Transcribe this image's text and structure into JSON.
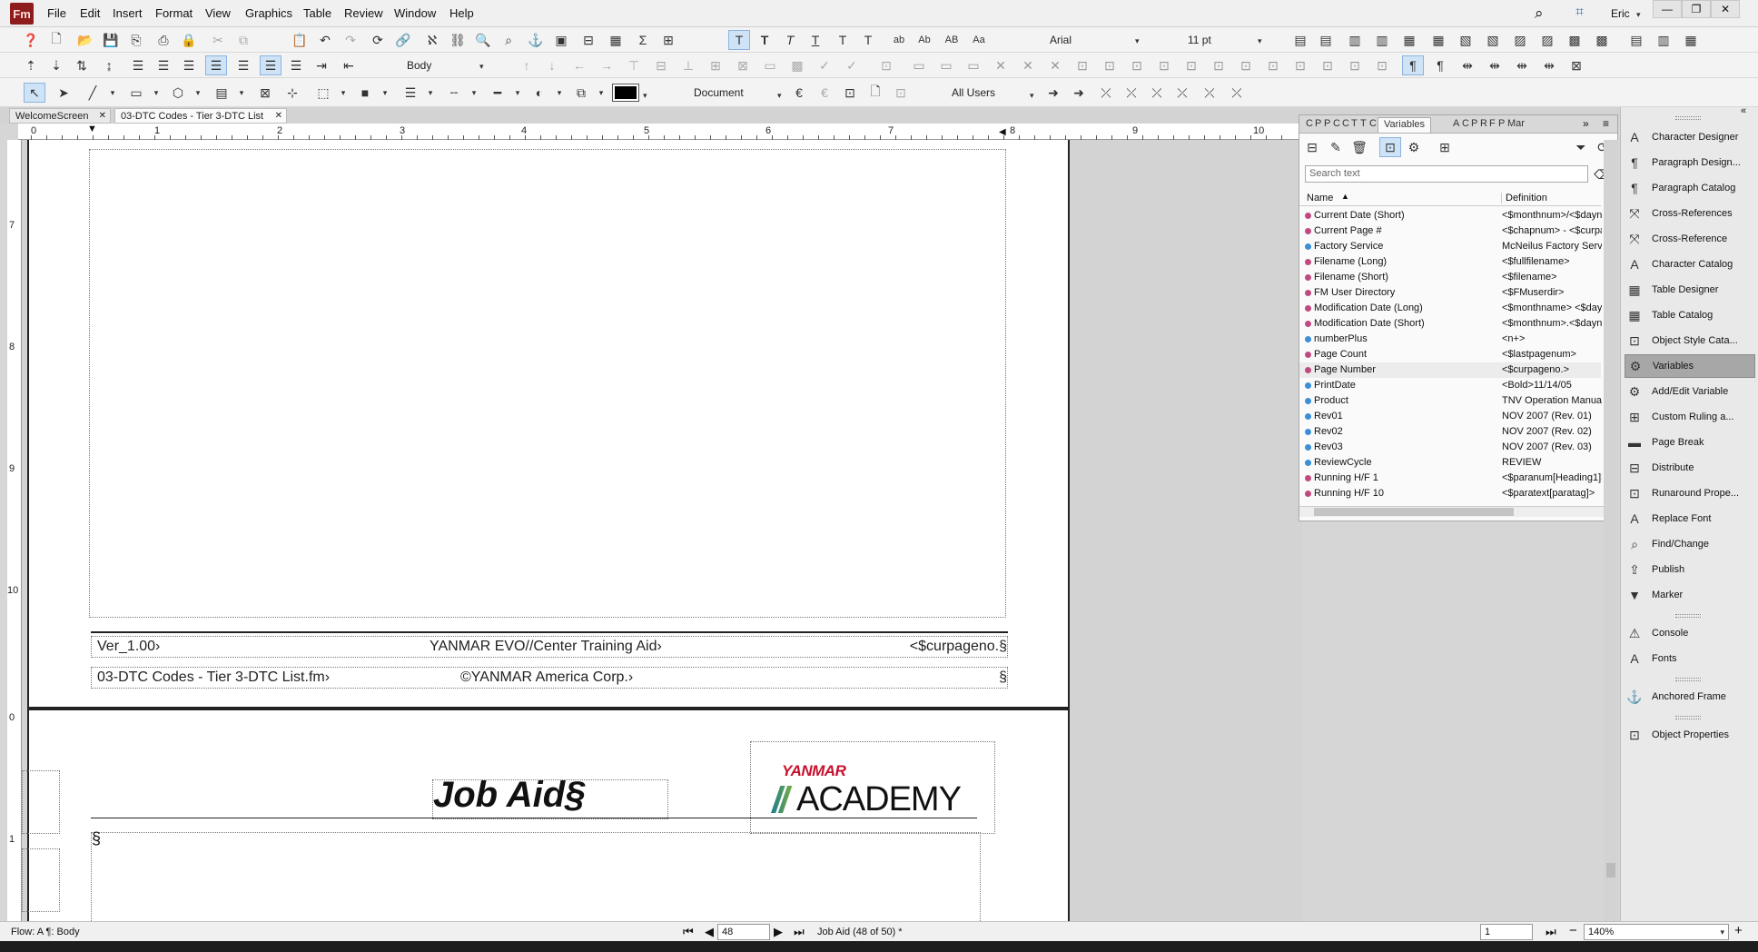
{
  "app": {
    "logo": "Fm",
    "user": "Eric"
  },
  "menu": [
    "File",
    "Edit",
    "Insert",
    "Format",
    "View",
    "Graphics",
    "Table",
    "Review",
    "Window",
    "Help"
  ],
  "toolbar": {
    "paragraph_style": "Body",
    "font": "Arial",
    "font_size": "11 pt",
    "text_buttons": [
      "T",
      "T",
      "T",
      "T",
      "T",
      "T",
      "ab",
      "Ab",
      "AB",
      "Aa"
    ],
    "track_scope": "Document",
    "users": "All Users"
  },
  "tabs": [
    {
      "label": "WelcomeScreen",
      "close": "✕"
    },
    {
      "label": "03-DTC Codes - Tier 3-DTC List",
      "close": "✕"
    }
  ],
  "ruler": {
    "h_marks": [
      "0",
      "1",
      "2",
      "3",
      "4",
      "5",
      "6",
      "7",
      "8",
      "9",
      "10"
    ],
    "v_marks": [
      "7",
      "8",
      "9",
      "10",
      "0",
      "1"
    ]
  },
  "page": {
    "footer_ver": "Ver_1.00›",
    "footer_center": "YANMAR EVO//Center Training Aid›",
    "footer_pageno": "<$curpageno.§",
    "footer_file": "03-DTC Codes - Tier 3-DTC List.fm›",
    "footer_copyright": "©YANMAR America Corp.›",
    "footer_end": "§",
    "next_title": "Job Aid§",
    "logo_top": "YANMAR",
    "logo_bottom": "ACADEMY",
    "body_marker": "§"
  },
  "variables_pod": {
    "tabs": [
      "C",
      "P",
      "P",
      "C",
      "C",
      "T",
      "T",
      "C",
      "Variables",
      "A",
      "C",
      "P",
      "R",
      "F",
      "P",
      "Mar"
    ],
    "active_tab": "Variables",
    "search_placeholder": "Search text",
    "col_name": "Name",
    "col_definition": "Definition",
    "rows": [
      {
        "name": "Current Date (Short)",
        "def": "<$monthnum>/<$dayn",
        "sys": true
      },
      {
        "name": "Current Page #",
        "def": "<$chapnum> - <$curpa",
        "sys": true
      },
      {
        "name": "Factory Service",
        "def": "McNeilus Factory Servi",
        "sys": false
      },
      {
        "name": "Filename (Long)",
        "def": "<$fullfilename>",
        "sys": true
      },
      {
        "name": "Filename (Short)",
        "def": "<$filename>",
        "sys": true
      },
      {
        "name": "FM User Directory",
        "def": "<$FMuserdir>",
        "sys": true
      },
      {
        "name": "Modification Date (Long)",
        "def": "<$monthname> <$dayr",
        "sys": true
      },
      {
        "name": "Modification Date (Short)",
        "def": "<$monthnum>.<$daynu",
        "sys": true
      },
      {
        "name": "numberPlus",
        "def": "<n+>",
        "sys": false
      },
      {
        "name": "Page Count",
        "def": "<$lastpagenum>",
        "sys": true
      },
      {
        "name": "Page Number",
        "def": "<$curpageno.>",
        "sys": true
      },
      {
        "name": "PrintDate",
        "def": "<Bold>11/14/05",
        "sys": false
      },
      {
        "name": "Product",
        "def": "TNV Operation Manual",
        "sys": false
      },
      {
        "name": "Rev01",
        "def": "NOV 2007 (Rev. 01)",
        "sys": false
      },
      {
        "name": "Rev02",
        "def": "NOV 2007 (Rev. 02)",
        "sys": false
      },
      {
        "name": "Rev03",
        "def": "NOV 2007 (Rev. 03)",
        "sys": false
      },
      {
        "name": "ReviewCycle",
        "def": "REVIEW",
        "sys": false
      },
      {
        "name": "Running H/F 1",
        "def": "<$paranum[Heading1]>",
        "sys": true
      },
      {
        "name": "Running H/F 10",
        "def": "<$paratext[paratag]>",
        "sys": true
      }
    ]
  },
  "right_panel": {
    "group1": [
      "Character Designer",
      "Paragraph Design...",
      "Paragraph Catalog",
      "Cross-References",
      "Cross-Reference",
      "Character Catalog",
      "Table Designer",
      "Table Catalog",
      "Object Style Cata...",
      "Variables",
      "Add/Edit Variable",
      "Custom Ruling a...",
      "Page Break",
      "Distribute",
      "Runaround Prope...",
      "Replace Font",
      "Find/Change",
      "Publish",
      "Marker"
    ],
    "group2": [
      "Console",
      "Fonts"
    ],
    "group3": [
      "Anchored Frame"
    ],
    "group4": [
      "Object Properties"
    ],
    "active": "Variables"
  },
  "status": {
    "flow": "Flow: A  ¶: Body",
    "page_input": "48",
    "page_info": "Job Aid (48 of 50) *",
    "view_input": "1",
    "zoom": "140%"
  }
}
